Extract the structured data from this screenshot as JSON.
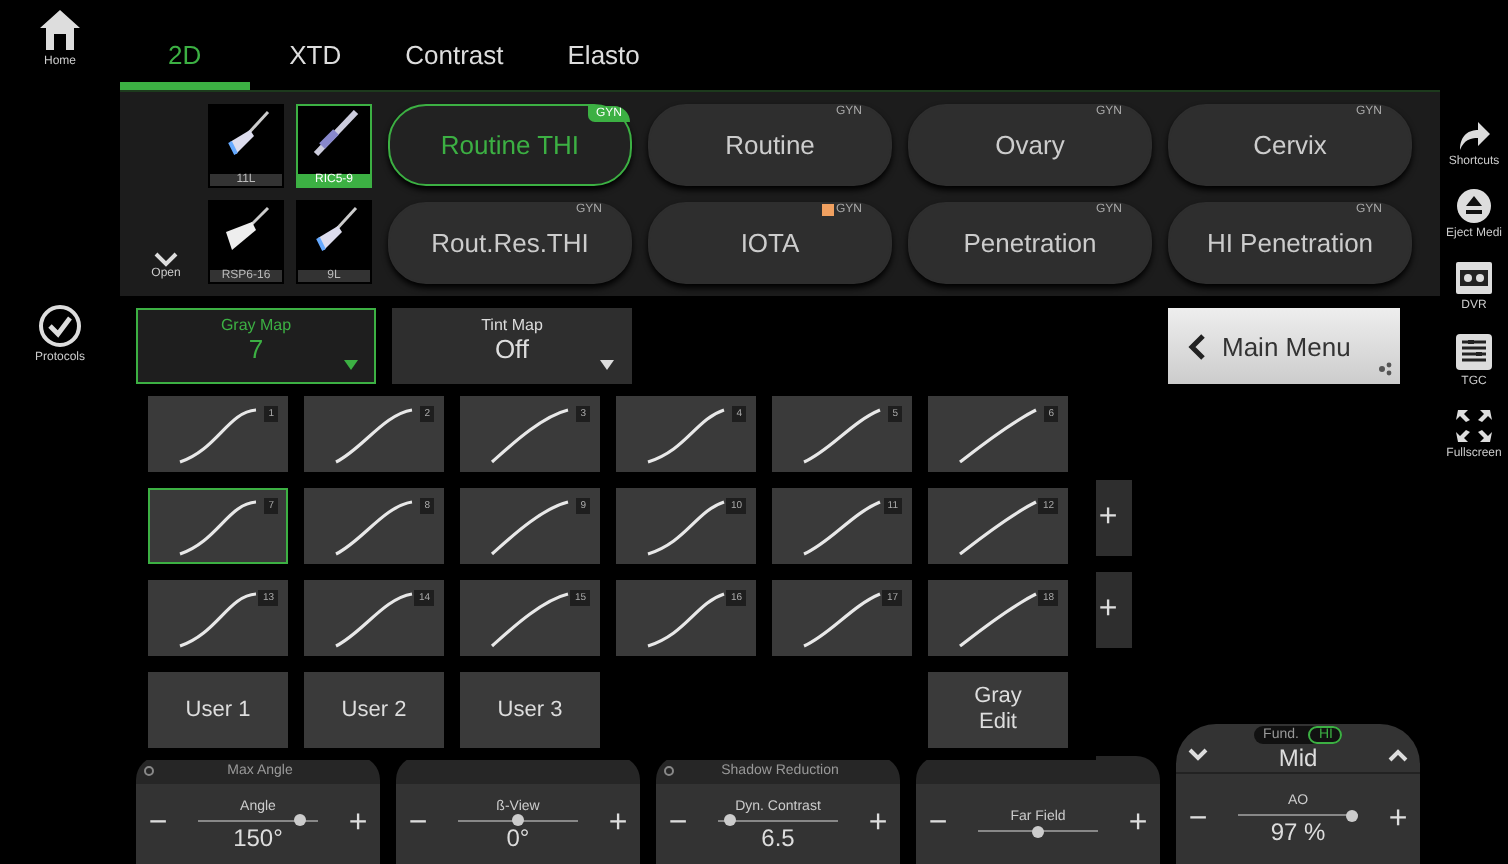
{
  "nav_left": [
    {
      "label": "Home",
      "kind": "home"
    },
    {
      "label": "Protocols",
      "kind": "check"
    }
  ],
  "tabs": [
    {
      "label": "2D",
      "selected": true
    },
    {
      "label": "XTD",
      "selected": false
    },
    {
      "label": "Contrast",
      "selected": false
    },
    {
      "label": "Elasto",
      "selected": false
    }
  ],
  "probes": [
    {
      "label": "11L",
      "selected": false,
      "kind": "linear"
    },
    {
      "label": "RIC5-9",
      "selected": true,
      "kind": "endo"
    },
    {
      "label": "RSP6-16",
      "selected": false,
      "kind": "wide"
    },
    {
      "label": "9L",
      "selected": false,
      "kind": "linear"
    }
  ],
  "open_button": {
    "label": "Open"
  },
  "presets": [
    {
      "label": "Routine THI",
      "badge": "GYN",
      "selected": true,
      "flag": false
    },
    {
      "label": "Routine",
      "badge": "GYN",
      "selected": false,
      "flag": false
    },
    {
      "label": "Ovary",
      "badge": "GYN",
      "selected": false,
      "flag": false
    },
    {
      "label": "Cervix",
      "badge": "GYN",
      "selected": false,
      "flag": false
    },
    {
      "label": "Rout.Res.THI",
      "badge": "GYN",
      "selected": false,
      "flag": false
    },
    {
      "label": "IOTA",
      "badge": "GYN",
      "selected": false,
      "flag": true
    },
    {
      "label": "Penetration",
      "badge": "GYN",
      "selected": false,
      "flag": false
    },
    {
      "label": "HI Penetration",
      "badge": "GYN",
      "selected": false,
      "flag": false
    }
  ],
  "map_dropdowns": [
    {
      "title": "Gray Map",
      "value": "7",
      "selected": true
    },
    {
      "title": "Tint Map",
      "value": "Off",
      "selected": false
    }
  ],
  "main_menu": {
    "label": "Main Menu"
  },
  "gray_maps": [
    {
      "label": "1",
      "selected": false
    },
    {
      "label": "2",
      "selected": false
    },
    {
      "label": "3",
      "selected": false
    },
    {
      "label": "4",
      "selected": false
    },
    {
      "label": "5",
      "selected": false
    },
    {
      "label": "6",
      "selected": false
    },
    {
      "label": "7",
      "selected": true
    },
    {
      "label": "8",
      "selected": false
    },
    {
      "label": "9",
      "selected": false
    },
    {
      "label": "10",
      "selected": false
    },
    {
      "label": "11",
      "selected": false
    },
    {
      "label": "12",
      "selected": false
    },
    {
      "label": "13",
      "selected": false
    },
    {
      "label": "14",
      "selected": false
    },
    {
      "label": "15",
      "selected": false
    },
    {
      "label": "16",
      "selected": false
    },
    {
      "label": "17",
      "selected": false
    },
    {
      "label": "18",
      "selected": false
    }
  ],
  "user_maps": [
    "User 1",
    "User 2",
    "User 3"
  ],
  "gray_edit": "Gray Edit",
  "plus_buttons": [
    "+",
    "+"
  ],
  "controls": [
    {
      "kind": "slider",
      "header": "Max Angle",
      "label": "Angle",
      "value": "150°",
      "level": 0.85,
      "minus": "−",
      "plus": "+"
    },
    {
      "kind": "slider",
      "label": "ß-View",
      "value": "0°",
      "level": 0.5,
      "minus": "−",
      "plus": "+"
    },
    {
      "kind": "slider",
      "header": "Shadow Reduction",
      "label": "Dyn. Contrast",
      "value": "6.5",
      "level": 0.1,
      "minus": "−",
      "plus": "+"
    },
    {
      "kind": "slider",
      "label": "Far Field",
      "level": 0.5,
      "minus": "−",
      "plus": "+"
    },
    {
      "kind": "mode",
      "toggle": [
        {
          "label": "Fund.",
          "selected": false
        },
        {
          "label": "HI",
          "selected": true
        }
      ],
      "mode": "Mid",
      "label": "AO",
      "value": "97 %",
      "level": 0.95,
      "minus": "−",
      "plus": "+"
    }
  ],
  "nav_right": [
    {
      "label": "Shortcuts",
      "kind": "arrow"
    },
    {
      "label": "Eject Medi",
      "kind": "eject"
    },
    {
      "label": "DVR",
      "kind": "dvr"
    },
    {
      "label": "TGC",
      "kind": "tgc"
    },
    {
      "label": "Fullscreen",
      "kind": "fullscreen"
    }
  ]
}
